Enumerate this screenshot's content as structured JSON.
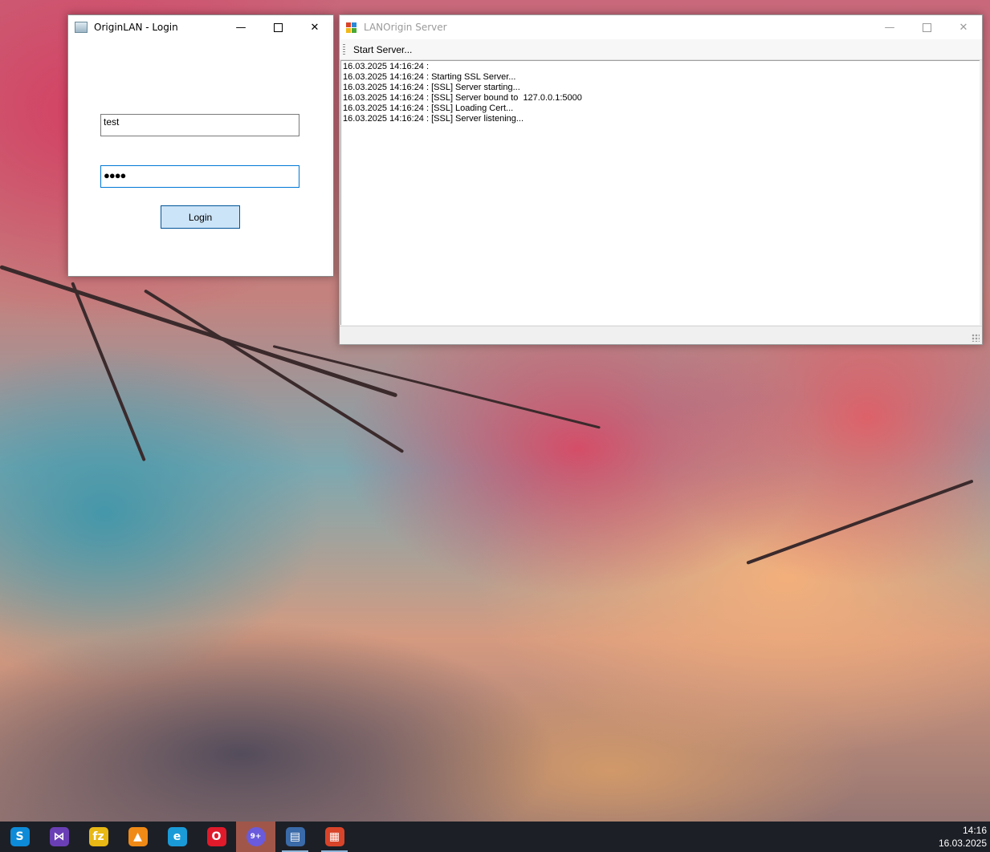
{
  "login_window": {
    "title": "OriginLAN - Login",
    "username_value": "test",
    "password_value": "●●●●",
    "login_button": "Login",
    "controls": {
      "minimize": "—",
      "close": "✕"
    }
  },
  "server_window": {
    "title": "LANOrigin Server",
    "toolbar": {
      "start_server": "Start Server..."
    },
    "log_lines": [
      "16.03.2025 14:16:24 :",
      "16.03.2025 14:16:24 : Starting SSL Server...",
      "16.03.2025 14:16:24 : [SSL] Server starting...",
      "16.03.2025 14:16:24 : [SSL] Server bound to  127.0.0.1:5000",
      "16.03.2025 14:16:24 : [SSL] Loading Cert...",
      "16.03.2025 14:16:24 : [SSL] Server listening..."
    ],
    "controls": {
      "minimize": "—",
      "close": "✕"
    }
  },
  "taskbar": {
    "apps": [
      {
        "icon": "skype-icon",
        "glyph": "S",
        "color": "#0d8bd8"
      },
      {
        "icon": "visual-studio-icon",
        "glyph": "⋈",
        "color": "#6a3fb5"
      },
      {
        "icon": "filezilla-icon",
        "glyph": "fz",
        "color": "#e8b814"
      },
      {
        "icon": "vlc-icon",
        "glyph": "▲",
        "color": "#f08a16"
      },
      {
        "icon": "edge-icon",
        "glyph": "e",
        "color": "#1a9bd8"
      },
      {
        "icon": "opera-icon",
        "glyph": "O",
        "color": "#e01a2a"
      },
      {
        "icon": "chat-app-icon",
        "glyph": "9+",
        "color": "#6a5adc"
      },
      {
        "icon": "login-window-icon",
        "glyph": "▤",
        "color": "#3a6aa8"
      },
      {
        "icon": "server-window-icon",
        "glyph": "▦",
        "color": "#d8442a"
      }
    ],
    "clock_time": "14:16",
    "clock_date": "16.03.2025"
  }
}
